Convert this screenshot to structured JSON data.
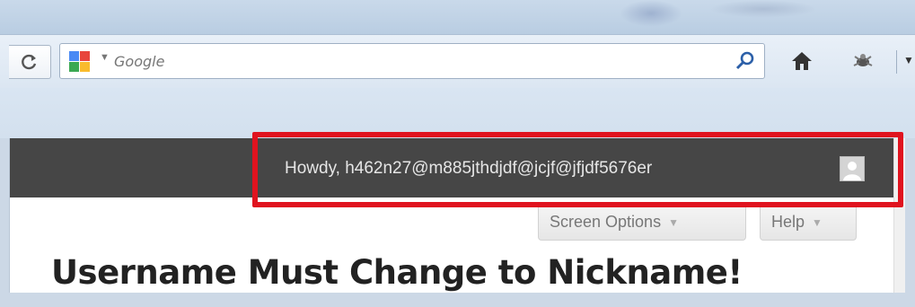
{
  "browser": {
    "search_engine_icon": "google-logo-icon",
    "search_placeholder": "Google",
    "reload_icon": "reload-icon",
    "search_go_icon": "magnifier-icon",
    "home_icon": "home-icon",
    "addon_icon": "addon-icon",
    "menu_caret_icon": "chevron-down-icon"
  },
  "admin_bar": {
    "greeting": "Howdy, h462n27@m885jthdjdf@jcjf@jfjdf5676er",
    "avatar_icon": "avatar-icon",
    "background": "#464646"
  },
  "screen_meta": {
    "screen_options_label": "Screen Options",
    "help_label": "Help",
    "arrow_glyph": "▼"
  },
  "page": {
    "heading": "Username Must Change to Nickname!"
  },
  "annotation": {
    "highlight_color": "#e0131f"
  }
}
